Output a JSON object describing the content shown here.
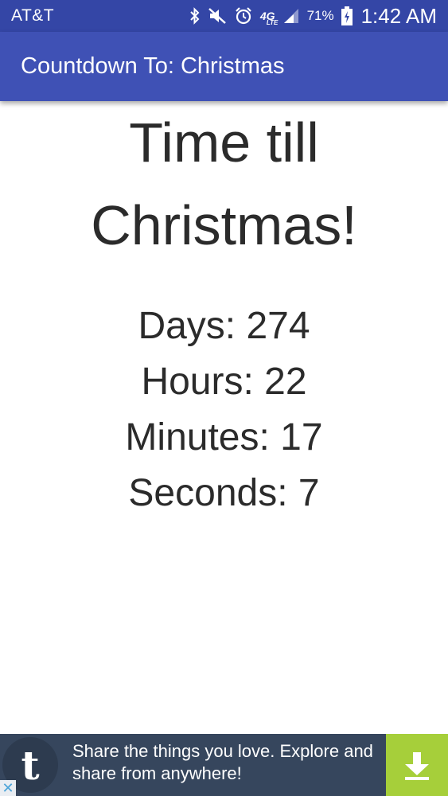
{
  "status_bar": {
    "carrier": "AT&T",
    "network": "4G",
    "network_sub": "LTE",
    "battery_percent": "71%",
    "time": "1:42 AM",
    "icons": [
      "bluetooth-icon",
      "mute-icon",
      "alarm-icon",
      "network-4g-lte-icon",
      "signal-icon",
      "battery-charging-icon"
    ]
  },
  "app_bar": {
    "title": "Countdown To: Christmas"
  },
  "main": {
    "headline_line1": "Time till",
    "headline_line2": "Christmas!",
    "counters": [
      {
        "label": "Days: 274"
      },
      {
        "label": "Hours: 22"
      },
      {
        "label": "Minutes: 17"
      },
      {
        "label": "Seconds: 7"
      }
    ]
  },
  "ad": {
    "logo_letter": "t",
    "text": "Share the things you love. Explore and share from anywhere!",
    "close_glyph": "✕",
    "cta_icon": "download-icon"
  },
  "colors": {
    "status_bar": "#3446a6",
    "app_bar": "#3f51b5",
    "ad_background": "#36465d",
    "ad_cta": "#a6cf3a",
    "text": "#2b2b2b"
  }
}
